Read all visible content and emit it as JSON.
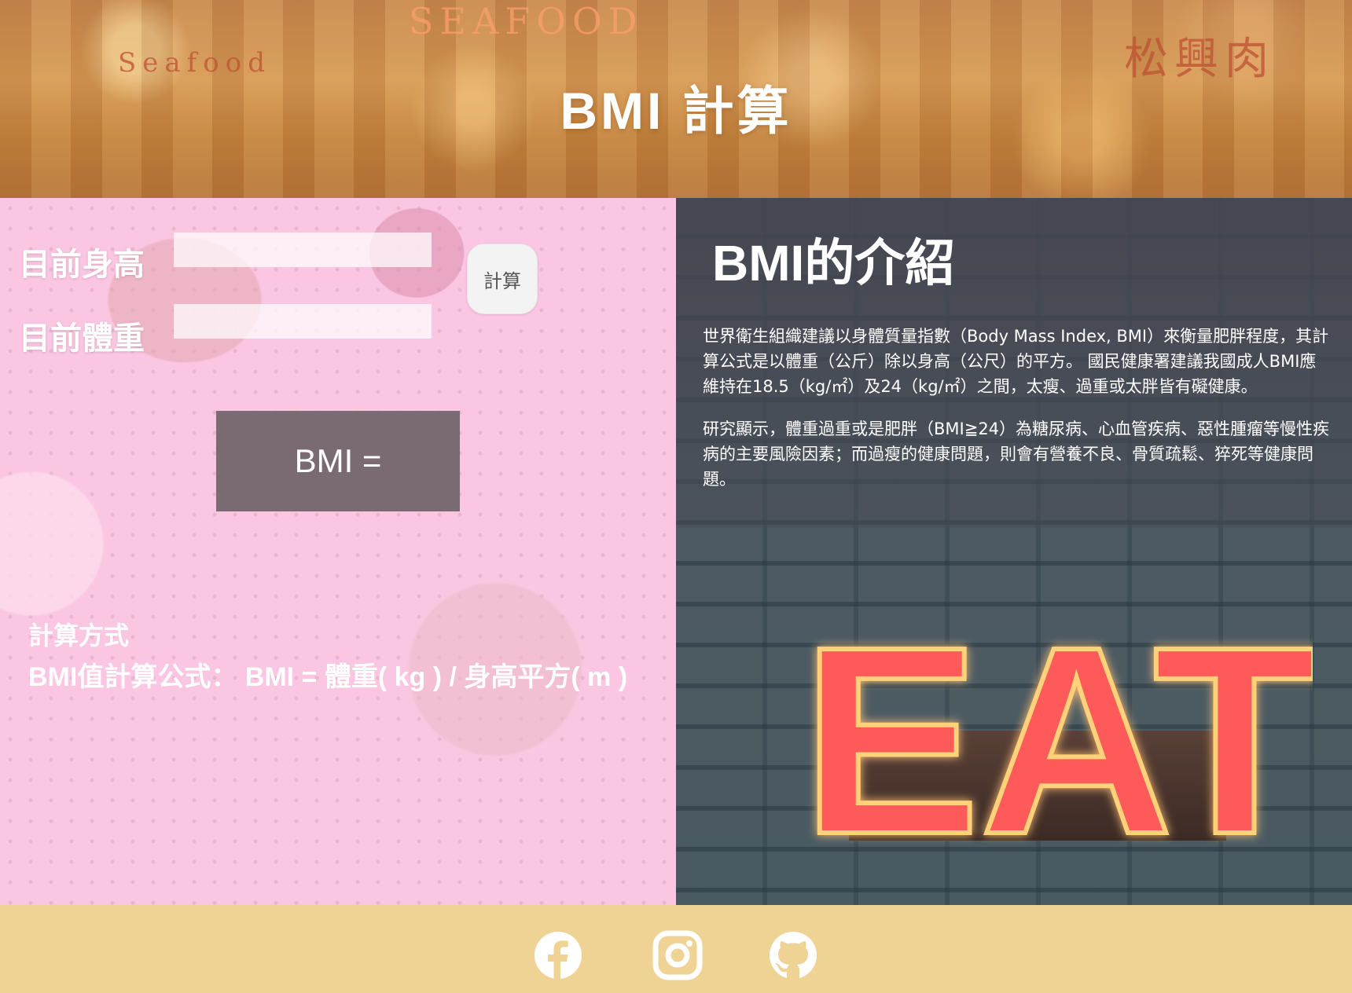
{
  "header": {
    "title": "BMI 計算",
    "sign_left": "Seafood",
    "sign_center": "SEAFOOD",
    "sign_right": "松興肉"
  },
  "calculator": {
    "height_label": "目前身高",
    "height_value": "",
    "weight_label": "目前體重",
    "weight_value": "",
    "calc_button_label": "計算",
    "result_text": "BMI ="
  },
  "method": {
    "title": "計算方式",
    "formula": "BMI值計算公式： BMI = 體重( kg ) / 身高平方( m )"
  },
  "info": {
    "heading": "BMI的介紹",
    "paragraph_1": "世界衛生組織建議以身體質量指數（Body Mass Index, BMI）來衡量肥胖程度，其計算公式是以體重（公斤）除以身高（公尺）的平方。 國民健康署建議我國成人BMI應維持在18.5（kg/㎡）及24（kg/㎡）之間，太瘦、過重或太胖皆有礙健康。",
    "paragraph_2": "研究顯示，體重過重或是肥胖（BMI≧24）為糖尿病、心血管疾病、惡性腫瘤等慢性疾病的主要風險因素；而過瘦的健康問題，則會有營養不良、骨質疏鬆、猝死等健康問題。",
    "neon_text": "EAT"
  },
  "footer": {
    "icons": [
      "facebook-icon",
      "instagram-icon",
      "github-icon"
    ]
  },
  "colors": {
    "footer_bg": "#eed394",
    "left_panel_bg": "#f9c6df",
    "result_box_bg": "#7a6a72",
    "neon": "#ff5a5a"
  }
}
